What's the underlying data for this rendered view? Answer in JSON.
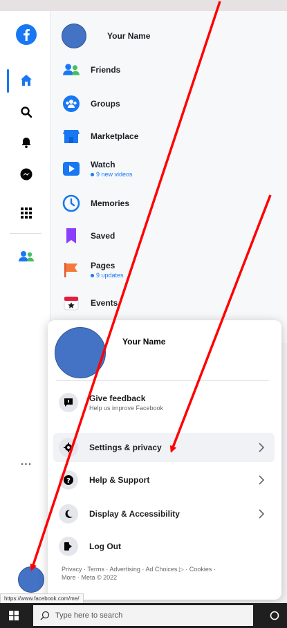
{
  "profile": {
    "name": "Your Name"
  },
  "sidebar": {
    "items": [
      {
        "label": "Your Name",
        "sub": ""
      },
      {
        "label": "Friends",
        "sub": ""
      },
      {
        "label": "Groups",
        "sub": ""
      },
      {
        "label": "Marketplace",
        "sub": ""
      },
      {
        "label": "Watch",
        "sub": "9 new videos"
      },
      {
        "label": "Memories",
        "sub": ""
      },
      {
        "label": "Saved",
        "sub": ""
      },
      {
        "label": "Pages",
        "sub": "9 updates"
      },
      {
        "label": "Events",
        "sub": ""
      }
    ]
  },
  "rail": {
    "icons": [
      "facebook-logo-icon",
      "home-icon",
      "search-icon",
      "bell-icon",
      "messenger-icon",
      "menu-grid-icon",
      "friends-icon"
    ],
    "more_label": "..."
  },
  "menu": {
    "profile_name": "Your Name",
    "feedback_title": "Give feedback",
    "feedback_sub": "Help us improve Facebook",
    "items": [
      {
        "label": "Settings & privacy",
        "icon": "gear-icon"
      },
      {
        "label": "Help & Support",
        "icon": "help-icon"
      },
      {
        "label": "Display & Accessibility",
        "icon": "moon-icon"
      },
      {
        "label": "Log Out",
        "icon": "logout-icon"
      }
    ],
    "footer_line1": "Privacy · Terms · Advertising · Ad Choices ▷ · Cookies ·",
    "footer_line2": "More · Meta © 2022"
  },
  "status": {
    "url": "https://www.facebook.com/me/"
  },
  "taskbar": {
    "search_placeholder": "Type here to search"
  },
  "colors": {
    "brand": "#1877f2",
    "avatar": "#4472c4",
    "annotation": "#ff0000"
  }
}
